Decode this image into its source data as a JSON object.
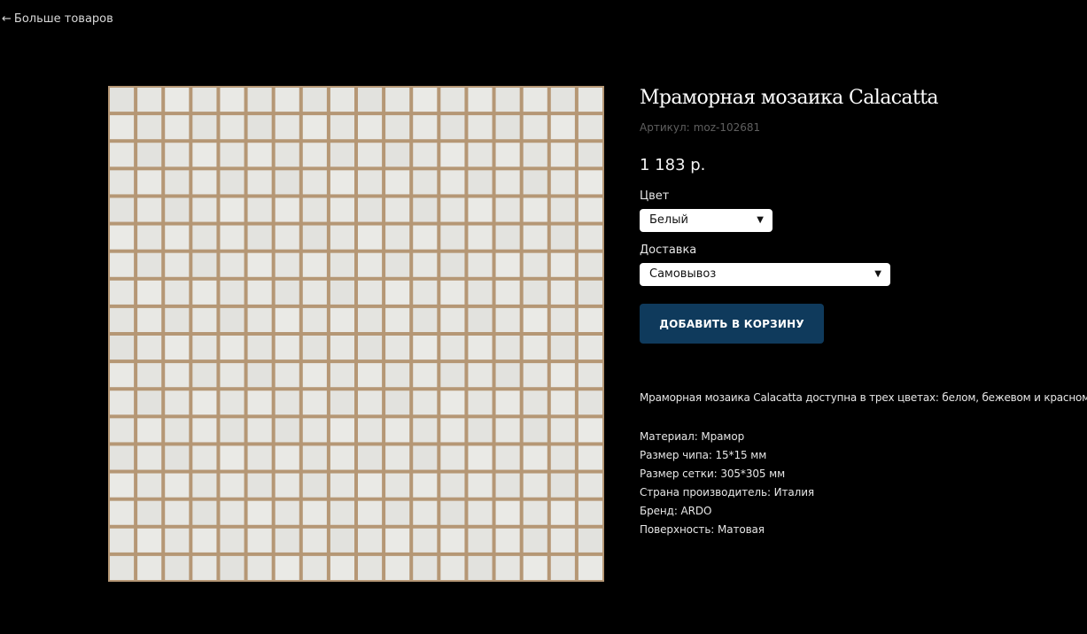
{
  "nav": {
    "back_arrow": "←",
    "back_label": "Больше товаров"
  },
  "product": {
    "title": "Мраморная мозаика Calacatta",
    "sku_label": "Артикул:",
    "sku_value": "moz-102681",
    "price": "1 183 р.",
    "color": {
      "label": "Цвет",
      "selected": "Белый"
    },
    "delivery": {
      "label": "Доставка",
      "selected": "Самовывоз"
    },
    "add_to_cart_label": "ДОБАВИТЬ В КОРЗИНУ",
    "description": "Мраморная мозаика Calacatta доступна в трех цветах: белом, бежевом и красном",
    "specs": [
      "Материал: Мрамор",
      "Размер чипа: 15*15 мм",
      "Размер сетки: 305*305 мм",
      "Страна производитель: Италия",
      "Бренд: ARDO",
      "Поверхность: Матовая"
    ]
  },
  "icons": {
    "dropdown": "caret-down-icon",
    "back": "arrow-left-icon"
  },
  "colors": {
    "background": "#000000",
    "button": "#0f3a5c",
    "tile": "#ebebe6",
    "grout": "#b59775",
    "sku_text": "#5f5f5f"
  }
}
